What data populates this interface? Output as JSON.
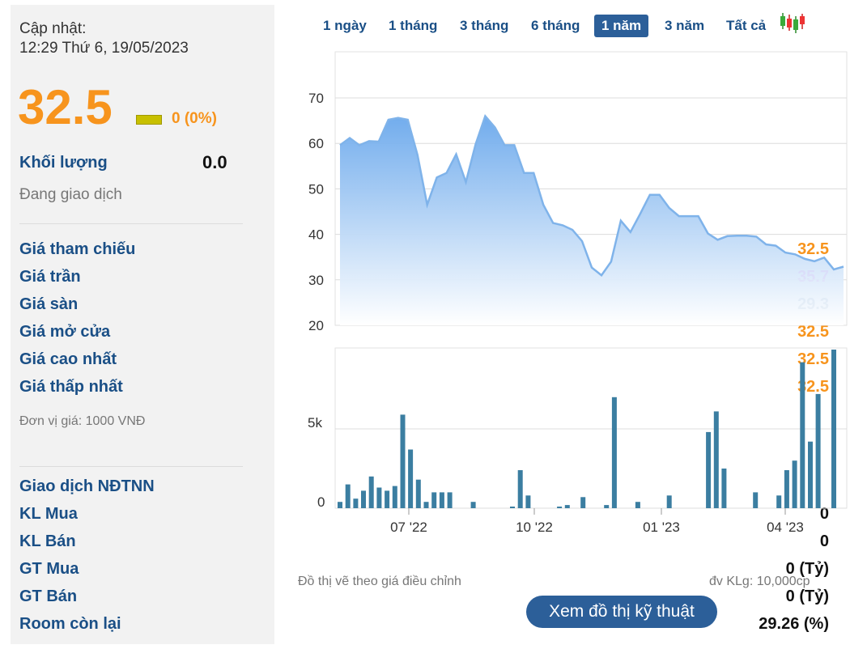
{
  "left": {
    "update_label": "Cập nhật:",
    "update_time": "12:29 Thứ 6, 19/05/2023",
    "price": "32.5",
    "change": "0 (0%)",
    "volume_label": "Khối lượng",
    "volume_value": "0.0",
    "status": "Đang giao dịch",
    "stats": [
      {
        "label": "Giá tham chiếu",
        "value": "32.5",
        "color": "#f7941d"
      },
      {
        "label": "Giá trần",
        "value": "35.7",
        "color": "#e600e6"
      },
      {
        "label": "Giá sàn",
        "value": "29.3",
        "color": "#1a4f86"
      },
      {
        "label": "Giá mở cửa",
        "value": "32.5",
        "color": "#f7941d"
      },
      {
        "label": "Giá cao nhất",
        "value": "32.5",
        "color": "#f7941d"
      },
      {
        "label": "Giá thấp nhất",
        "value": "32.5",
        "color": "#f7941d"
      }
    ],
    "unit_note": "Đơn vị giá: 1000 VNĐ",
    "foreign": {
      "title": "Giao dịch NĐTNN",
      "rows": [
        {
          "label": "KL Mua",
          "value": "0"
        },
        {
          "label": "KL Bán",
          "value": "0"
        },
        {
          "label": "GT Mua",
          "value": "0 (Tỷ)"
        },
        {
          "label": "GT Bán",
          "value": "0 (Tỷ)"
        },
        {
          "label": "Room còn lại",
          "value": "29.26 (%)"
        }
      ]
    }
  },
  "tabs": [
    "1 ngày",
    "1 tháng",
    "3 tháng",
    "6 tháng",
    "1 năm",
    "3 năm",
    "Tất cả"
  ],
  "active_tab": "1 năm",
  "footer": {
    "note_left": "Đồ thị vẽ theo giá điều chỉnh",
    "note_right": "đv KLg: 10,000cp",
    "tech_button": "Xem đồ thị kỹ thuật"
  },
  "chart_data": [
    {
      "type": "area",
      "yticks": [
        20,
        30,
        40,
        50,
        60,
        70
      ],
      "ylim": [
        20,
        70
      ],
      "xtick_labels": [
        "07 '22",
        "10 '22",
        "01 '23",
        "04 '23"
      ],
      "color": "#7fb3ea",
      "series": [
        {
          "values": [
            59.6,
            61.2,
            59.6,
            60.5,
            60.4,
            65.2,
            65.6,
            65.2,
            57.5,
            46.5,
            52.5,
            53.5,
            57.6,
            51.5,
            59.8,
            66.0,
            63.5,
            59.6,
            59.6,
            53.5,
            53.5,
            46.5,
            42.5,
            42.0,
            41.0,
            38.5,
            32.7,
            31.0,
            34.0,
            43.0,
            40.5,
            44.5,
            48.7,
            48.7,
            45.8,
            44.0,
            44.0,
            44.0,
            40.2,
            38.8,
            39.6,
            39.7,
            39.7,
            39.5,
            37.8,
            37.5,
            36.0,
            35.6,
            34.6,
            34.1,
            34.9,
            32.3,
            32.9
          ]
        }
      ]
    },
    {
      "type": "bar",
      "yticks": [
        0,
        5
      ],
      "ytick_labels": [
        "0",
        "5k"
      ],
      "ylim": [
        0,
        8
      ],
      "xtick_labels": [
        "07 '22",
        "10 '22",
        "01 '23",
        "04 '23"
      ],
      "color": "#3b7ea1",
      "series": [
        {
          "values": [
            0.4,
            1.5,
            0.6,
            1.1,
            2.0,
            1.3,
            1.1,
            1.4,
            5.9,
            3.7,
            1.8,
            0.4,
            1.0,
            1.0,
            1.0,
            0,
            0,
            0.4,
            0,
            0,
            0,
            0,
            0.1,
            2.4,
            0.8,
            0,
            0,
            0,
            0.1,
            0.2,
            0,
            0.7,
            0,
            0,
            0.2,
            7.0,
            0,
            0,
            0.4,
            0,
            0,
            0,
            0.8,
            0,
            0,
            0,
            0,
            4.8,
            6.1,
            2.5,
            0,
            0,
            0,
            1.0,
            0,
            0,
            0.8,
            2.4,
            3.0,
            9.2,
            4.2,
            7.2,
            0,
            10.0
          ]
        }
      ]
    }
  ]
}
